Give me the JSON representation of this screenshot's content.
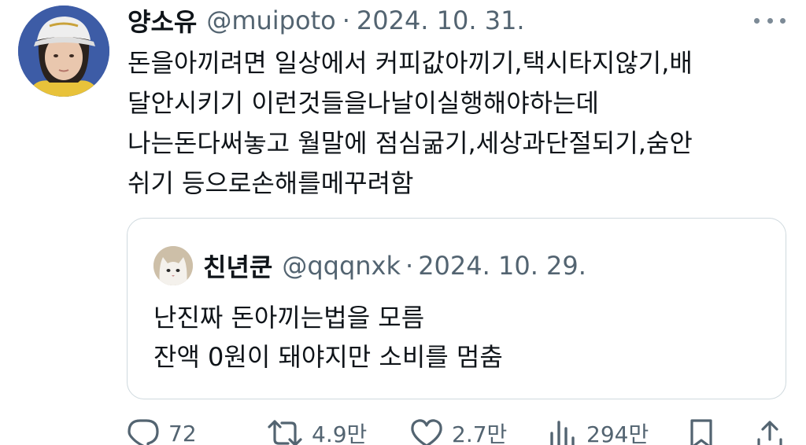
{
  "tweet": {
    "display_name": "양소유",
    "handle": "@muipoto",
    "separator": "·",
    "date": "2024. 10. 31.",
    "lines": [
      "돈을아끼려면 일상에서 커피값아끼기,택시타지않기,배",
      "달안시키기 이런것들을나날이실행해야하는데",
      "나는돈다써놓고 월말에 점심굶기,세상과단절되기,숨안",
      "쉬기 등으로손해를메꾸려함"
    ]
  },
  "quote": {
    "display_name": "친년쿤",
    "handle": "@qqqnxk",
    "separator": "·",
    "date": "2024. 10. 29.",
    "lines": [
      "난진짜 돈아끼는법을 모름",
      "잔액 0원이 돼야지만 소비를 멈춤"
    ]
  },
  "actions": {
    "replies": "72",
    "retweets": "4.9만",
    "likes": "2.7만",
    "views": "294만"
  },
  "icons": {
    "reply": "reply-icon",
    "retweet": "retweet-icon",
    "like": "heart-icon",
    "views": "views-chart-icon",
    "bookmark": "bookmark-icon",
    "share": "share-icon",
    "more": "more-dots-icon"
  },
  "colors": {
    "text": "#0f1419",
    "secondary": "#536471",
    "border": "#cfd9de"
  }
}
